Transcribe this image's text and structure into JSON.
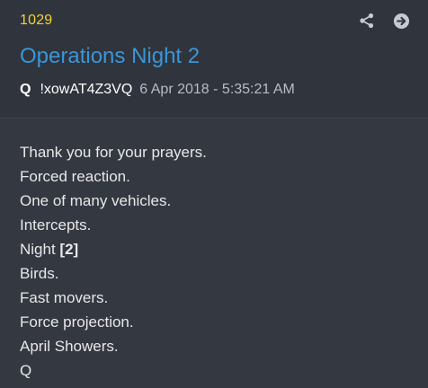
{
  "post": {
    "number": "1029",
    "title": "Operations Night 2",
    "author": "Q",
    "tripcode": "!xowAT4Z3VQ",
    "date": "6 Apr 2018 - 5:35:21 AM"
  },
  "icons": {
    "share": "share-icon",
    "open": "arrow-right-circle-icon"
  },
  "colors": {
    "number": "#f2d23a",
    "title": "#3a96d8",
    "background": "#343841"
  },
  "body": {
    "line1": "Thank you for your prayers.",
    "line2": "Forced reaction.",
    "line3": "One of many vehicles.",
    "line4": "Intercepts.",
    "line5_prefix": "Night ",
    "line5_bold": "[2]",
    "line6": "Birds.",
    "line7": "Fast movers.",
    "line8": "Force projection.",
    "line9": "April Showers.",
    "line10": "Q"
  }
}
